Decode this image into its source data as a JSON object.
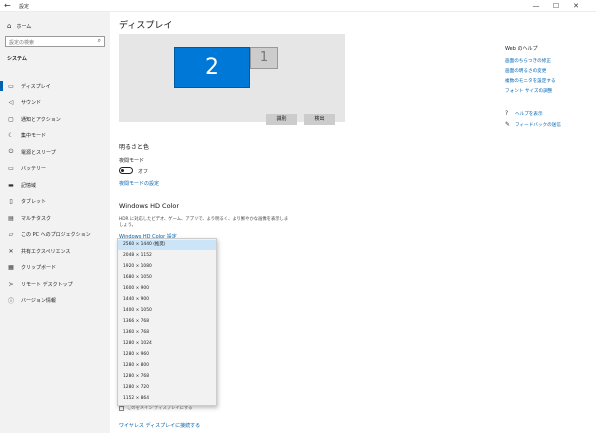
{
  "window": {
    "title": "設定",
    "back_icon": "back-arrow-icon",
    "minimize_glyph": "—",
    "maximize_glyph": "☐",
    "close_glyph": "✕"
  },
  "sidebar": {
    "home_label": "ホーム",
    "search_placeholder": "設定の検索",
    "section_title": "システム",
    "items": [
      {
        "label": "ディスプレイ",
        "icon": "monitor-icon",
        "glyph": "▭",
        "active": true
      },
      {
        "label": "サウンド",
        "icon": "speaker-icon",
        "glyph": "◁"
      },
      {
        "label": "通知とアクション",
        "icon": "notification-icon",
        "glyph": "▢"
      },
      {
        "label": "集中モード",
        "icon": "moon-icon",
        "glyph": "☾"
      },
      {
        "label": "電源とスリープ",
        "icon": "power-icon",
        "glyph": "⏻"
      },
      {
        "label": "バッテリー",
        "icon": "battery-icon",
        "glyph": "▭"
      },
      {
        "label": "記憶域",
        "icon": "storage-icon",
        "glyph": "▬"
      },
      {
        "label": "タブレット",
        "icon": "tablet-icon",
        "glyph": "▯"
      },
      {
        "label": "マルチタスク",
        "icon": "multitask-icon",
        "glyph": "▤"
      },
      {
        "label": "この PC へのプロジェクション",
        "icon": "projection-icon",
        "glyph": "▱"
      },
      {
        "label": "共有エクスペリエンス",
        "icon": "share-icon",
        "glyph": "✕"
      },
      {
        "label": "クリップボード",
        "icon": "clipboard-icon",
        "glyph": "▦"
      },
      {
        "label": "リモート デスクトップ",
        "icon": "remote-desktop-icon",
        "glyph": "≻"
      },
      {
        "label": "バージョン情報",
        "icon": "info-icon",
        "glyph": "ⓘ"
      }
    ]
  },
  "main": {
    "title": "ディスプレイ",
    "monitor_primary": "2",
    "monitor_secondary": "1",
    "identify_label": "識別",
    "detect_label": "検出",
    "brightness_heading": "明るさと色",
    "night_mode_label": "夜間モード",
    "night_mode_state": "オフ",
    "night_mode_link": "夜間モードの設定",
    "hdr_heading": "Windows HD Color",
    "hdr_description": "HDR に対応したビデオ、ゲーム、アプリで、より明るく、より鮮やかな画像を表示しましょう。",
    "hdr_link": "Windows HD Color 設定",
    "below_dropdown_text": "このをメイン ディスプレイにする",
    "wireless_link": "ワイヤレス ディスプレイに接続する"
  },
  "resolution_dropdown": {
    "options": [
      "2560 × 1440 (推奨)",
      "2048 × 1152",
      "1920 × 1080",
      "1680 × 1050",
      "1600 × 900",
      "1440 × 900",
      "1400 × 1050",
      "1366 × 768",
      "1360 × 768",
      "1280 × 1024",
      "1280 × 960",
      "1280 × 800",
      "1280 × 768",
      "1280 × 720",
      "1152 × 864"
    ],
    "selected_index": 0
  },
  "right_panel": {
    "web_help_title": "Web のヘルプ",
    "links": [
      "画面のちらつきの修正",
      "画面の明るさの変更",
      "複数のモニタを設定する",
      "フォント サイズの調整"
    ],
    "help_label": "ヘルプを表示",
    "feedback_label": "フィードバックの送信"
  },
  "colors": {
    "accent": "#0078d7",
    "link": "#0063b1",
    "sidebar_bg": "#f2f2f2",
    "dropdown_selected": "#cce4f7"
  }
}
